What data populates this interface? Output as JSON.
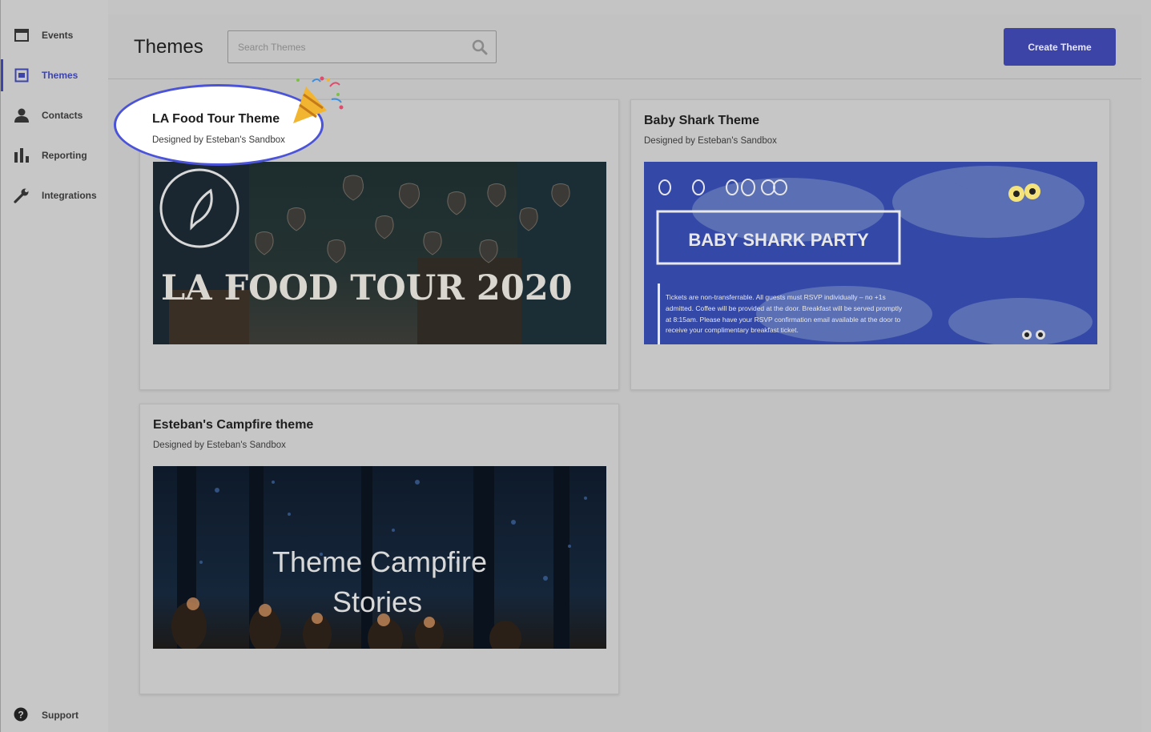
{
  "sidebar": {
    "items": [
      {
        "label": "Events",
        "icon": "calendar-icon"
      },
      {
        "label": "Themes",
        "icon": "themes-icon",
        "active": true
      },
      {
        "label": "Contacts",
        "icon": "person-icon"
      },
      {
        "label": "Reporting",
        "icon": "bar-chart-icon"
      },
      {
        "label": "Integrations",
        "icon": "wrench-icon"
      }
    ],
    "support_label": "Support"
  },
  "header": {
    "title": "Themes",
    "search_placeholder": "Search Themes",
    "create_button": "Create Theme"
  },
  "themes": [
    {
      "title": "LA Food Tour Theme",
      "designer": "Designed by Esteban's Sandbox",
      "image_text": "LA FOOD TOUR 2020",
      "highlighted": true
    },
    {
      "title": "Baby Shark Theme",
      "designer": "Designed by Esteban's Sandbox",
      "image_text": "BABY SHARK PARTY",
      "image_body": [
        "Tickets are non-transferrable. All guests must RSVP individually – no +1s",
        "admitted. Coffee will be provided at the door. Breakfast will be served promptly",
        "at 8:15am. Please have your RSVP confirmation email available at the door to",
        "receive your complimentary breakfast ticket."
      ]
    },
    {
      "title": "Esteban's Campfire theme",
      "designer": "Designed by Esteban's Sandbox",
      "image_text_lines": [
        "Theme Campfire",
        "Stories"
      ]
    }
  ],
  "colors": {
    "accent": "#3d44a8",
    "highlight_ring": "#4b53d9",
    "overlay_bg": "#c4c4c4"
  }
}
